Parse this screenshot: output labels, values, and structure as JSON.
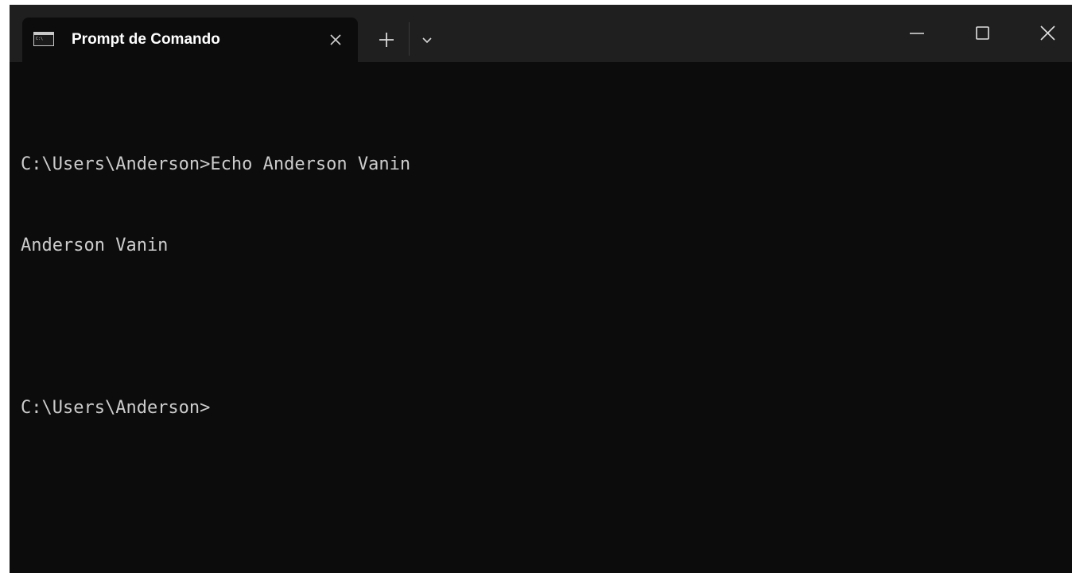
{
  "tab": {
    "title": "Prompt de Comando",
    "icon": "cmd-terminal-icon"
  },
  "tab_actions": {
    "close_icon": "close-icon",
    "new_tab_icon": "plus-icon",
    "dropdown_icon": "chevron-down-icon"
  },
  "window_controls": {
    "minimize_icon": "minimize-icon",
    "maximize_icon": "maximize-icon",
    "close_icon": "close-icon"
  },
  "console": {
    "lines": [
      "C:\\Users\\Anderson>Echo Anderson Vanin",
      "Anderson Vanin",
      "",
      "C:\\Users\\Anderson>"
    ]
  },
  "colors": {
    "titlebar": "#1f1f1f",
    "terminal_bg": "#0c0c0c",
    "terminal_text": "#cccccc"
  }
}
